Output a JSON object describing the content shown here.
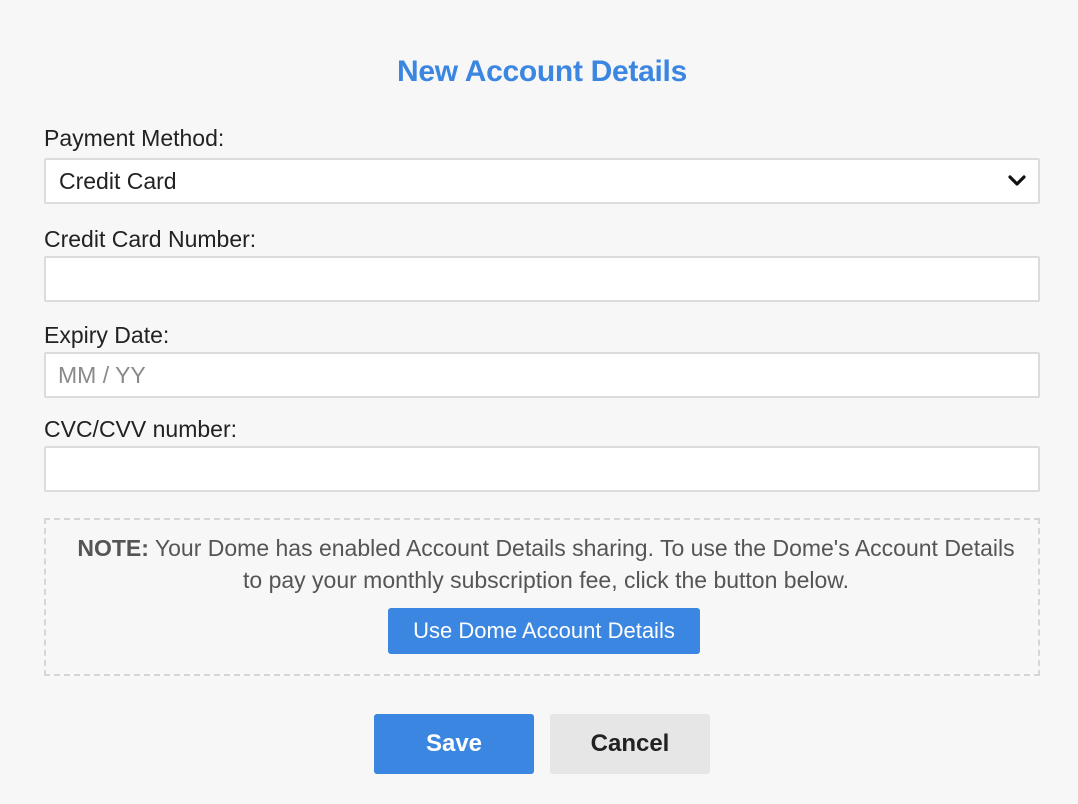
{
  "dialog": {
    "title": "New Account Details"
  },
  "form": {
    "payment_method": {
      "label": "Payment Method:",
      "selected": "Credit Card",
      "icon": "chevron-down-icon"
    },
    "card_number": {
      "label": "Credit Card Number:",
      "value": "",
      "placeholder": ""
    },
    "expiry": {
      "label": "Expiry Date:",
      "value": "",
      "placeholder": "MM / YY"
    },
    "cvc": {
      "label": "CVC/CVV number:",
      "value": "",
      "placeholder": ""
    }
  },
  "note": {
    "prefix": "NOTE:",
    "text": " Your Dome has enabled Account Details sharing. To use the Dome's Account Details to pay your monthly subscription fee, click the button below.",
    "button_label": "Use Dome Account Details"
  },
  "actions": {
    "save_label": "Save",
    "cancel_label": "Cancel"
  },
  "colors": {
    "accent": "#3b86e0",
    "background": "#f7f7f7",
    "secondary_button": "#e6e6e6"
  }
}
